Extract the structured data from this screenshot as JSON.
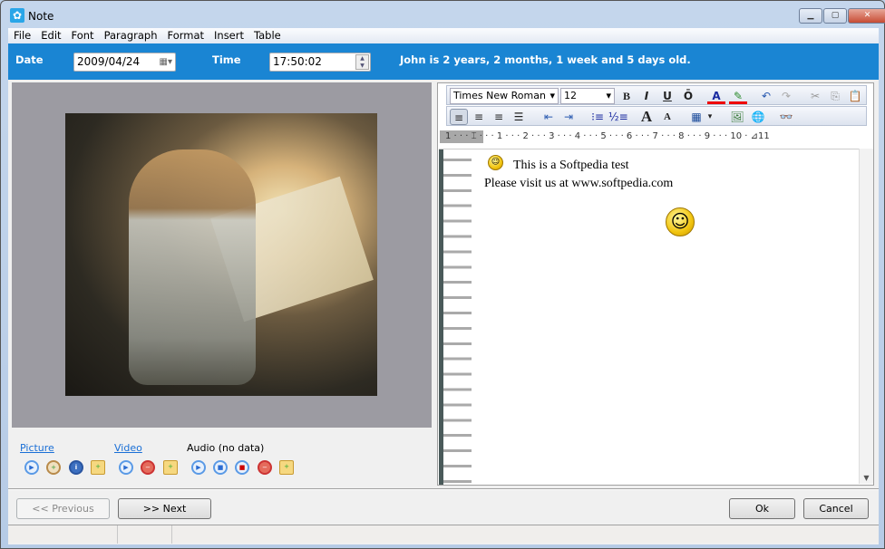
{
  "window": {
    "title": "Note",
    "minimize": "▁",
    "maximize": "▢",
    "close": "✕"
  },
  "menu": [
    "File",
    "Edit",
    "Font",
    "Paragraph",
    "Format",
    "Insert",
    "Table"
  ],
  "header": {
    "date_label": "Date",
    "date_value": "2009/04/24",
    "time_label": "Time",
    "time_value": "17:50:02",
    "age_text": "John is 2 years, 2 months, 1 week and 5 days old."
  },
  "media": {
    "picture": "Picture",
    "video": "Video",
    "audio": "Audio  (no data)"
  },
  "editor": {
    "font": "Times New Roman",
    "size": "12",
    "bold": "B",
    "italic": "I",
    "underline": "U",
    "overline": "Ō",
    "ruler": "1 · · · ⌶ · · · 1 · · · 2 · · · 3 · · · 4 · · · 5 · · · 6 · · · 7 · · · 8 · · · 9 · · · 10 · ⊿11",
    "lines": [
      "This is a Softpedia test",
      "Please visit us at www.softpedia.com"
    ]
  },
  "buttons": {
    "previous": "<< Previous",
    "next": ">> Next",
    "ok": "Ok",
    "cancel": "Cancel"
  },
  "colors": {
    "header_band": "#1a85d3",
    "link": "#1a6fd6"
  }
}
